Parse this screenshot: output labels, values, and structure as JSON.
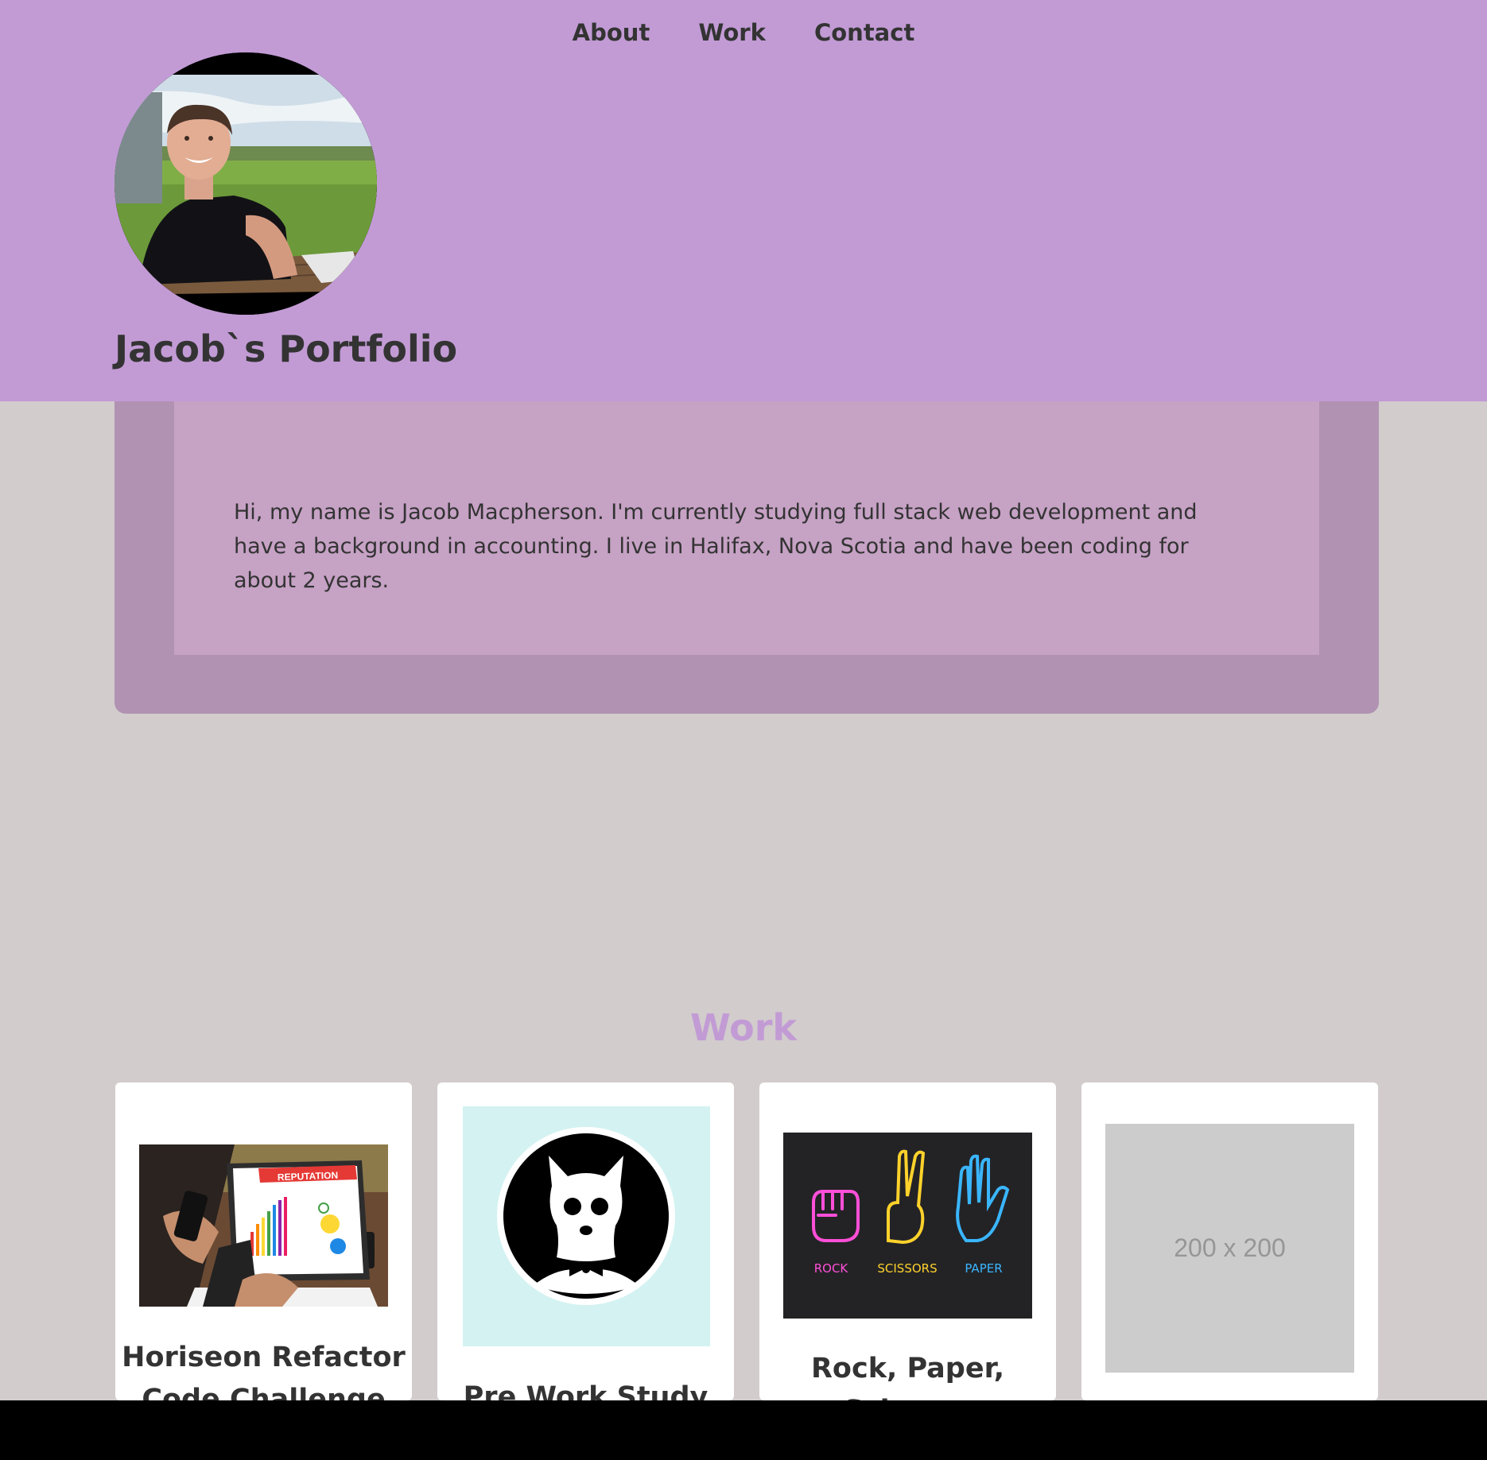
{
  "nav": {
    "items": [
      "About",
      "Work",
      "Contact"
    ]
  },
  "header": {
    "title": "Jacob`s Portfolio",
    "avatar_alt": "profile photo"
  },
  "about": {
    "text": "Hi, my name is Jacob Macpherson. I'm currently studying full stack web development and have a background in accounting. I live in Halifax, Nova Scotia and have been coding for about 2 years."
  },
  "work": {
    "heading": "Work",
    "projects": [
      {
        "title": "Horiseon Refactor Code Challenge",
        "image_text": "REPUTATION"
      },
      {
        "title": "Pre Work Study Guide"
      },
      {
        "title": "Rock, Paper, Scissors",
        "labels": [
          "ROCK",
          "SCISSORS",
          "PAPER"
        ]
      },
      {
        "title": "",
        "placeholder": "200 x 200"
      }
    ]
  },
  "colors": {
    "header_bg": "#c29bd5",
    "page_bg": "#d2cccd",
    "about_outer": "#b192b2",
    "about_inner": "#c6a2c5",
    "accent": "#c29bd5",
    "text": "#333333"
  }
}
